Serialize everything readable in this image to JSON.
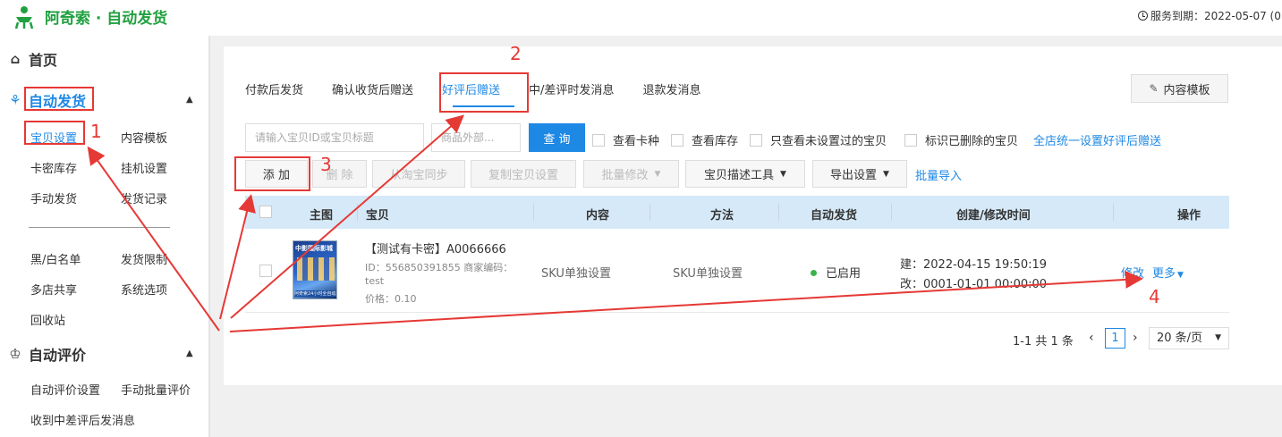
{
  "header": {
    "app_title": "阿奇索 · 自动发货",
    "service_expiry": "服务到期：2022-05-07 (0"
  },
  "sidebar": {
    "home": "首页",
    "auto_ship": "自动发货",
    "auto_ship_items": [
      "宝贝设置",
      "内容模板",
      "卡密库存",
      "挂机设置",
      "手动发货",
      "发货记录"
    ],
    "other_items": [
      "黑/白名单",
      "发货限制",
      "多店共享",
      "系统选项",
      "回收站"
    ],
    "auto_review": "自动评价",
    "auto_review_items": [
      "自动评价设置",
      "手动批量评价",
      "收到中差评后发消息"
    ]
  },
  "tabs": [
    "付款后发货",
    "确认收货后赠送",
    "好评后赠送",
    "中/差评时发消息",
    "退款发消息"
  ],
  "content_template_button": "内容模板",
  "search": {
    "item_placeholder": "请输入宝贝ID或宝贝标题",
    "outer_placeholder": "商品外部...",
    "query_button": "查 询"
  },
  "filters": [
    "查看卡种",
    "查看库存",
    "只查看未设置过的宝贝",
    "标识已删除的宝贝"
  ],
  "store_wide_link": "全店统一设置好评后赠送",
  "toolbar": {
    "add": "添 加",
    "delete": "删 除",
    "sync": "从淘宝同步",
    "copy": "复制宝贝设置",
    "batch_edit": "批量修改",
    "desc_tool": "宝贝描述工具",
    "export": "导出设置",
    "batch_import": "批量导入"
  },
  "table": {
    "headers": [
      "主图",
      "宝贝",
      "内容",
      "方法",
      "自动发货",
      "创建/修改时间",
      "操作"
    ],
    "rows": [
      {
        "thumb_title": "中影国际影城",
        "thumb_caption": "阿奇索24小时全自动发货",
        "title": "【测试有卡密】A0066666",
        "id_line": "ID：556850391855  商家编码：",
        "code": "test",
        "price": "价格：0.10",
        "content": "SKU单独设置",
        "method": "SKU单独设置",
        "status": "已启用",
        "created": "建：2022-04-15 19:50:19",
        "modified": "改：0001-01-01 00:00:00",
        "edit": "修改",
        "more": "更多"
      }
    ]
  },
  "pagination": {
    "summary": "1-1 共 1 条",
    "current_page": "1",
    "page_size": "20 条/页"
  },
  "annotations": [
    "1",
    "2",
    "3",
    "4"
  ],
  "colors": {
    "accent": "#1e88e5",
    "brand": "#20a040",
    "annotation": "#e53935"
  }
}
